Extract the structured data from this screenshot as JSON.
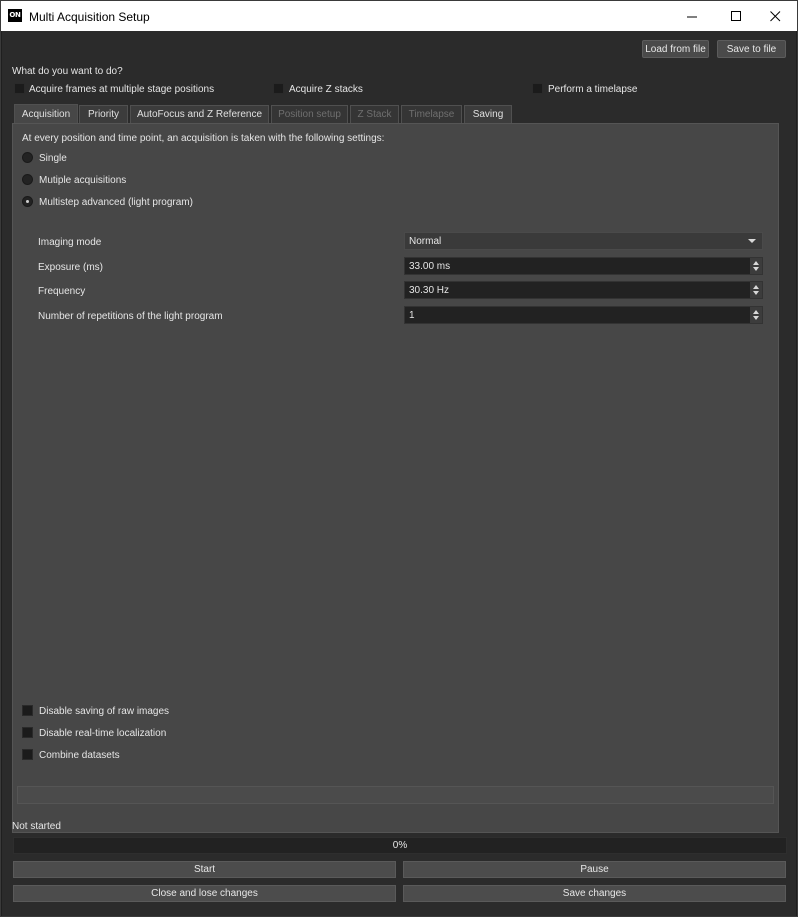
{
  "window": {
    "logo_text": "ON",
    "title": "Multi Acquisition Setup",
    "controls": [
      "minimize-icon",
      "maximize-icon",
      "close-icon"
    ]
  },
  "toolbar": {
    "load_label": "Load from file",
    "save_label": "Save to file"
  },
  "question": "What do you want to do?",
  "options": {
    "stage_positions": "Acquire frames at multiple stage positions",
    "z_stacks": "Acquire Z stacks",
    "timelapse": "Perform a timelapse"
  },
  "tabs": [
    {
      "label": "Acquisition",
      "state": "active"
    },
    {
      "label": "Priority",
      "state": "enabled"
    },
    {
      "label": "AutoFocus and Z Reference",
      "state": "enabled"
    },
    {
      "label": "Position setup",
      "state": "disabled"
    },
    {
      "label": "Z Stack",
      "state": "disabled"
    },
    {
      "label": "Timelapse",
      "state": "disabled"
    },
    {
      "label": "Saving",
      "state": "enabled"
    }
  ],
  "acquisition": {
    "intro": "At every position and time point, an acquisition is taken with the following settings:",
    "modes": [
      {
        "label": "Single",
        "selected": false
      },
      {
        "label": "Mutiple acquisitions",
        "selected": false
      },
      {
        "label": "Multistep advanced (light program)",
        "selected": true
      }
    ],
    "settings": {
      "imaging_mode_label": "Imaging mode",
      "imaging_mode_value": "Normal",
      "exposure_label": "Exposure (ms)",
      "exposure_value": "33.00 ms",
      "frequency_label": "Frequency",
      "frequency_value": "30.30 Hz",
      "repetitions_label": "Number of repetitions of the light program",
      "repetitions_value": "1"
    },
    "bottom_options": {
      "disable_raw": "Disable saving of raw images",
      "disable_localization": "Disable real-time localization",
      "combine": "Combine datasets"
    }
  },
  "status": {
    "text": "Not started",
    "progress_text": "0%",
    "progress_fraction": 0
  },
  "actions": {
    "start": "Start",
    "pause": "Pause",
    "close_lose": "Close and lose changes",
    "save_changes": "Save changes"
  },
  "colors": {
    "background": "#2b2b2b",
    "panel": "#474747",
    "field": "#222222",
    "button": "#4a4a4a",
    "text": "#e6e6e6"
  }
}
